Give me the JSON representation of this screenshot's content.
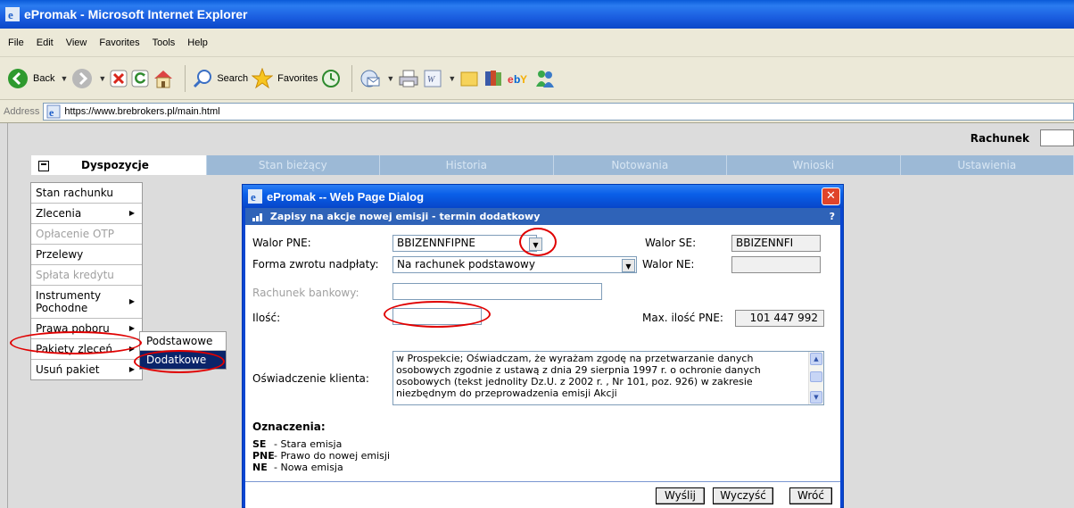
{
  "browser": {
    "title": "ePromak - Microsoft Internet Explorer",
    "menu": [
      "File",
      "Edit",
      "View",
      "Favorites",
      "Tools",
      "Help"
    ],
    "toolbar": {
      "back": "Back",
      "search": "Search",
      "favorites": "Favorites"
    },
    "address_label": "Address",
    "address_url": "https://www.brebrokers.pl/main.html"
  },
  "page": {
    "account_label": "Rachunek",
    "tabs": [
      {
        "label": "Dyspozycje",
        "active": true
      },
      {
        "label": "Stan bieżący"
      },
      {
        "label": "Historia"
      },
      {
        "label": "Notowania"
      },
      {
        "label": "Wnioski"
      },
      {
        "label": "Ustawienia"
      }
    ],
    "side_menu": [
      {
        "label": "Stan rachunku",
        "disabled": false,
        "submenu": false
      },
      {
        "label": "Zlecenia",
        "disabled": false,
        "submenu": true
      },
      {
        "label": "Opłacenie OTP",
        "disabled": true,
        "submenu": false
      },
      {
        "label": "Przelewy",
        "disabled": false,
        "submenu": false
      },
      {
        "label": "Spłata kredytu",
        "disabled": true,
        "submenu": false
      },
      {
        "label": "Instrumenty Pochodne",
        "disabled": false,
        "submenu": true
      },
      {
        "label": "Prawa poboru",
        "disabled": false,
        "submenu": true
      },
      {
        "label": "Pakiety zleceń",
        "disabled": false,
        "submenu": true
      },
      {
        "label": "Usuń pakiet",
        "disabled": false,
        "submenu": true
      }
    ],
    "submenu": [
      "Podstawowe",
      "Dodatkowe"
    ]
  },
  "dialog": {
    "title": "ePromak -- Web Page Dialog",
    "header": "Zapisy na akcje nowej emisji - termin dodatkowy",
    "help": "?",
    "fields": {
      "walor_pne_label": "Walor PNE:",
      "walor_pne_value": "BBIZENNFIPNE",
      "walor_se_label": "Walor SE:",
      "walor_se_value": "BBIZENNFI",
      "forma_label": "Forma zwrotu nadpłaty:",
      "forma_value": "Na rachunek podstawowy",
      "walor_ne_label": "Walor NE:",
      "walor_ne_value": "",
      "rachunek_label": "Rachunek bankowy:",
      "rachunek_value": "",
      "ilosc_label": "Ilość:",
      "ilosc_value": "",
      "max_label": "Max. ilość PNE:",
      "max_value": "101 447 992",
      "oswiadczenie_label": "Oświadczenie klienta:",
      "oswiadczenie_text": "w Prospekcie; Oświadczam, że wyrażam zgodę na przetwarzanie danych osobowych zgodnie z ustawą z dnia 29 sierpnia 1997 r. o ochronie danych osobowych (tekst jednolity Dz.U. z 2002 r. , Nr 101, poz. 926) w zakresie niezbędnym do przeprowadzenia emisji Akcji"
    },
    "legend": {
      "title": "Oznaczenia:",
      "items": [
        {
          "code": "SE",
          "desc": "- Stara emisja"
        },
        {
          "code": "PNE",
          "desc": "- Prawo do nowej emisji"
        },
        {
          "code": "NE",
          "desc": "- Nowa emisja"
        }
      ]
    },
    "buttons": {
      "send": "Wyślij",
      "clear": "Wyczyść",
      "back": "Wróć"
    }
  },
  "colors": {
    "highlight_ring": "#e00000",
    "tab_inactive": "#9cb9d6",
    "dialog_header": "#2f63b8"
  }
}
